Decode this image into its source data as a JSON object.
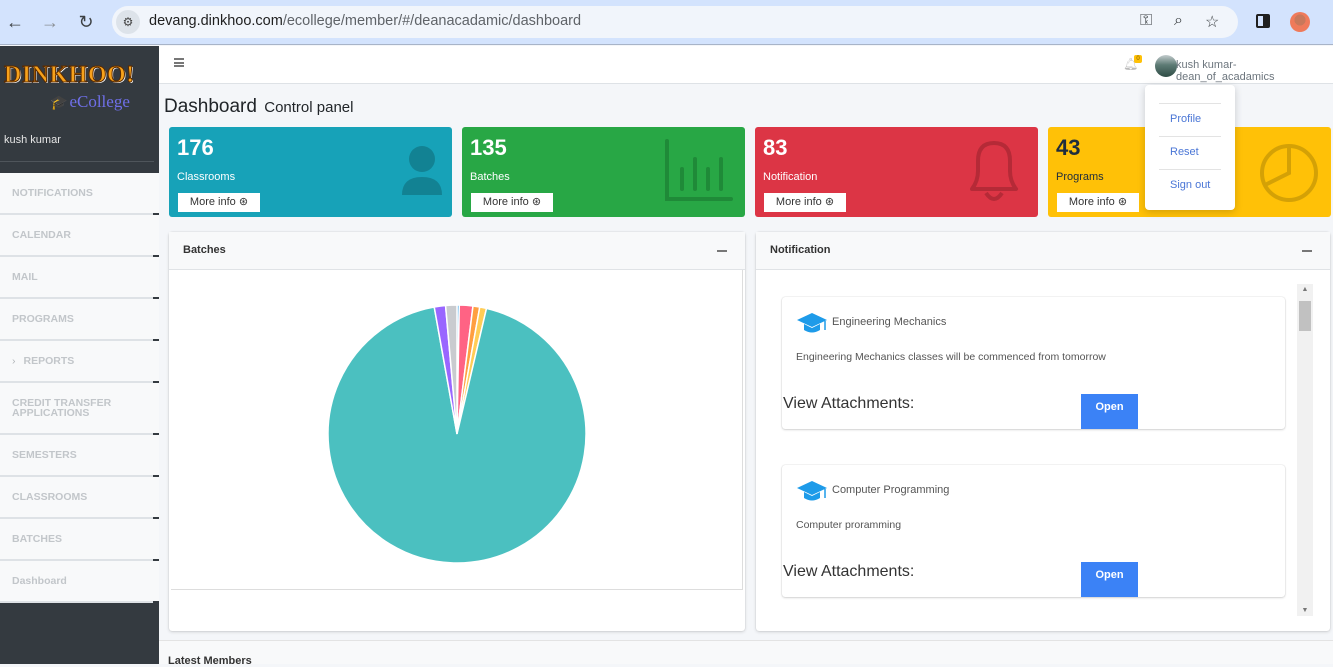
{
  "browser": {
    "url_host": "devang.dinkhoo.com",
    "url_path": "/ecollege/member/#/deanacadamic/dashboard",
    "icons": [
      "back-icon",
      "forward-icon",
      "reload-icon",
      "site-settings-icon",
      "password-key-icon",
      "zoom-icon",
      "bookmark-star-icon",
      "side-panel-icon",
      "profile-avatar"
    ]
  },
  "sidebar": {
    "logo_text": "DINKHOO!",
    "logo_sub": "eCollege",
    "user": "kush kumar",
    "items": [
      {
        "label": "NOTIFICATIONS"
      },
      {
        "label": "CALENDAR"
      },
      {
        "label": "MAIL"
      },
      {
        "label": "PROGRAMS"
      },
      {
        "label": "REPORTS",
        "expandable": true
      },
      {
        "label": "CREDIT TRANSFER APPLICATIONS"
      },
      {
        "label": "SEMESTERS"
      },
      {
        "label": "CLASSROOMS"
      },
      {
        "label": "BATCHES"
      },
      {
        "label": "Dashboard"
      }
    ]
  },
  "topbar": {
    "notification_count": "0",
    "user_label": "kush kumar-dean_of_acadamics"
  },
  "user_menu": {
    "items": [
      "Profile",
      "Reset",
      "Sign out"
    ]
  },
  "header": {
    "title": "Dashboard",
    "subtitle": "Control panel"
  },
  "stat_boxes": [
    {
      "value": "176",
      "label": "Classrooms",
      "more": "More info",
      "color": "#17a2b8",
      "icon": "user-icon"
    },
    {
      "value": "135",
      "label": "Batches",
      "more": "More info",
      "color": "#28a745",
      "icon": "bar-chart-icon"
    },
    {
      "value": "83",
      "label": "Notification",
      "more": "More info",
      "color": "#dc3545",
      "icon": "bell-icon"
    },
    {
      "value": "43",
      "label": "Programs",
      "more": "More info",
      "color": "#ffc107",
      "icon": "pie-chart-icon"
    }
  ],
  "batches_card": {
    "title": "Batches"
  },
  "notification_card": {
    "title": "Notification",
    "items": [
      {
        "title": "Engineering Mechanics",
        "body": "Engineering Mechanics classes will be commenced from tomorrow",
        "attach_label": "View Attachments:",
        "open_label": "Open"
      },
      {
        "title": "Computer Programming",
        "body": "Computer proramming",
        "attach_label": "View Attachments:",
        "open_label": "Open"
      }
    ]
  },
  "bottom": {
    "title": "Latest Members"
  },
  "chart_data": {
    "type": "pie",
    "title": "Batches",
    "categories": [
      "slice-1",
      "slice-2",
      "slice-3",
      "slice-4",
      "slice-5",
      "slice-6",
      "slice-7"
    ],
    "values": [
      1,
      6,
      3,
      3,
      331,
      5,
      5
    ],
    "colors": [
      "#36a2eb",
      "#ff6384",
      "#ff9f40",
      "#ffcd56",
      "#4bc0c0",
      "#9966ff",
      "#c9cbcf"
    ],
    "start": "top",
    "direction": "clockwise",
    "legend": "none"
  }
}
